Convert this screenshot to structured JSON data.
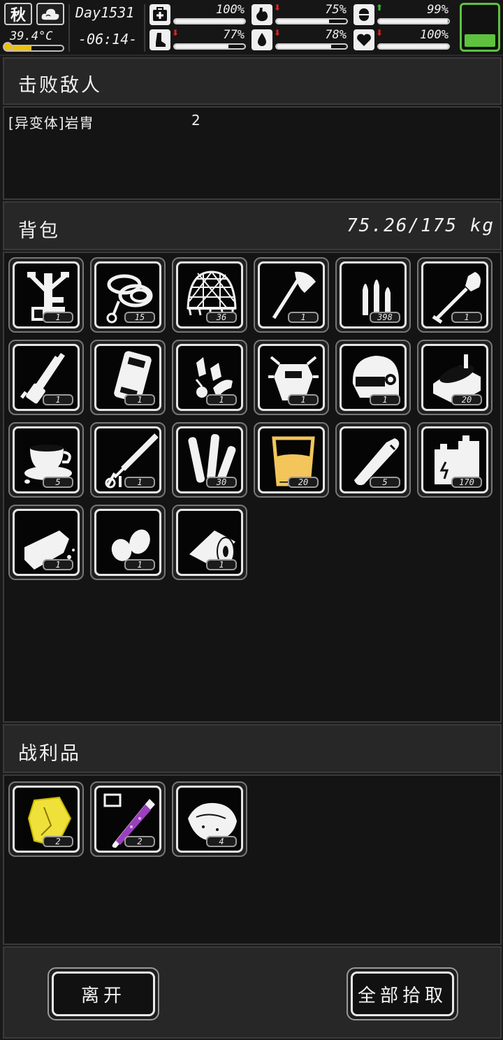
{
  "status": {
    "season": "秋",
    "weather_icon": "cloud-icon",
    "temperature": "39.4°C",
    "temperature_level": 0.45,
    "day": "Day1531",
    "time": "-06:14-",
    "stats": [
      {
        "name": "health",
        "icon": "medkit-icon",
        "value": "100%",
        "level": 1.0,
        "trend": ""
      },
      {
        "name": "hunger",
        "icon": "stomach-icon",
        "value": "75%",
        "level": 0.75,
        "trend": "down"
      },
      {
        "name": "mood",
        "icon": "pill-icon",
        "value": "99%",
        "level": 0.99,
        "trend": "up"
      },
      {
        "name": "stamina",
        "icon": "leg-icon",
        "value": "77%",
        "level": 0.77,
        "trend": "down"
      },
      {
        "name": "thirst",
        "icon": "water-drop-icon",
        "value": "78%",
        "level": 0.78,
        "trend": "down"
      },
      {
        "name": "heart",
        "icon": "heart-icon",
        "value": "100%",
        "level": 1.0,
        "trend": "down"
      }
    ],
    "battery_level": 0.3,
    "colors": {
      "accent_green": "#5ec23e",
      "arrow_red": "#e02020",
      "arrow_green": "#2fc02f",
      "temp_yellow": "#f0c000"
    }
  },
  "defeated": {
    "title": "击败敌人",
    "enemies": [
      {
        "name": "[异变体]岩胄",
        "count": "2"
      }
    ]
  },
  "backpack": {
    "title": "背包",
    "weight": "75.26/175 kg",
    "items": [
      {
        "icon": "machine-part-icon",
        "qty": "1"
      },
      {
        "icon": "rope-icon",
        "qty": "15"
      },
      {
        "icon": "net-icon",
        "qty": "36"
      },
      {
        "icon": "axe-icon",
        "qty": "1"
      },
      {
        "icon": "bullets-icon",
        "qty": "398"
      },
      {
        "icon": "shovel-icon",
        "qty": "1"
      },
      {
        "icon": "minigun-icon",
        "qty": "1"
      },
      {
        "icon": "armor-plate-icon",
        "qty": "1"
      },
      {
        "icon": "gloves-icon",
        "qty": "1"
      },
      {
        "icon": "mech-armor-icon",
        "qty": "1"
      },
      {
        "icon": "helmet-icon",
        "qty": "1"
      },
      {
        "icon": "canned-food-icon",
        "qty": "20"
      },
      {
        "icon": "coffee-icon",
        "qty": "5"
      },
      {
        "icon": "syringe-icon",
        "qty": "1"
      },
      {
        "icon": "tubes-icon",
        "qty": "30"
      },
      {
        "icon": "juice-cup-icon",
        "qty": "20"
      },
      {
        "icon": "cigar-icon",
        "qty": "5"
      },
      {
        "icon": "battery-pack-icon",
        "qty": "170"
      },
      {
        "icon": "bread-icon",
        "qty": "1"
      },
      {
        "icon": "seeds-icon",
        "qty": "1"
      },
      {
        "icon": "bandage-icon",
        "qty": "1"
      }
    ]
  },
  "loot": {
    "title": "战利品",
    "items": [
      {
        "icon": "yellow-crystal-icon",
        "qty": "2"
      },
      {
        "icon": "purple-test-tube-icon",
        "qty": "2"
      },
      {
        "icon": "raw-meat-icon",
        "qty": "4"
      }
    ]
  },
  "actions": {
    "leave_label": "离开",
    "take_all_label": "全部拾取"
  }
}
